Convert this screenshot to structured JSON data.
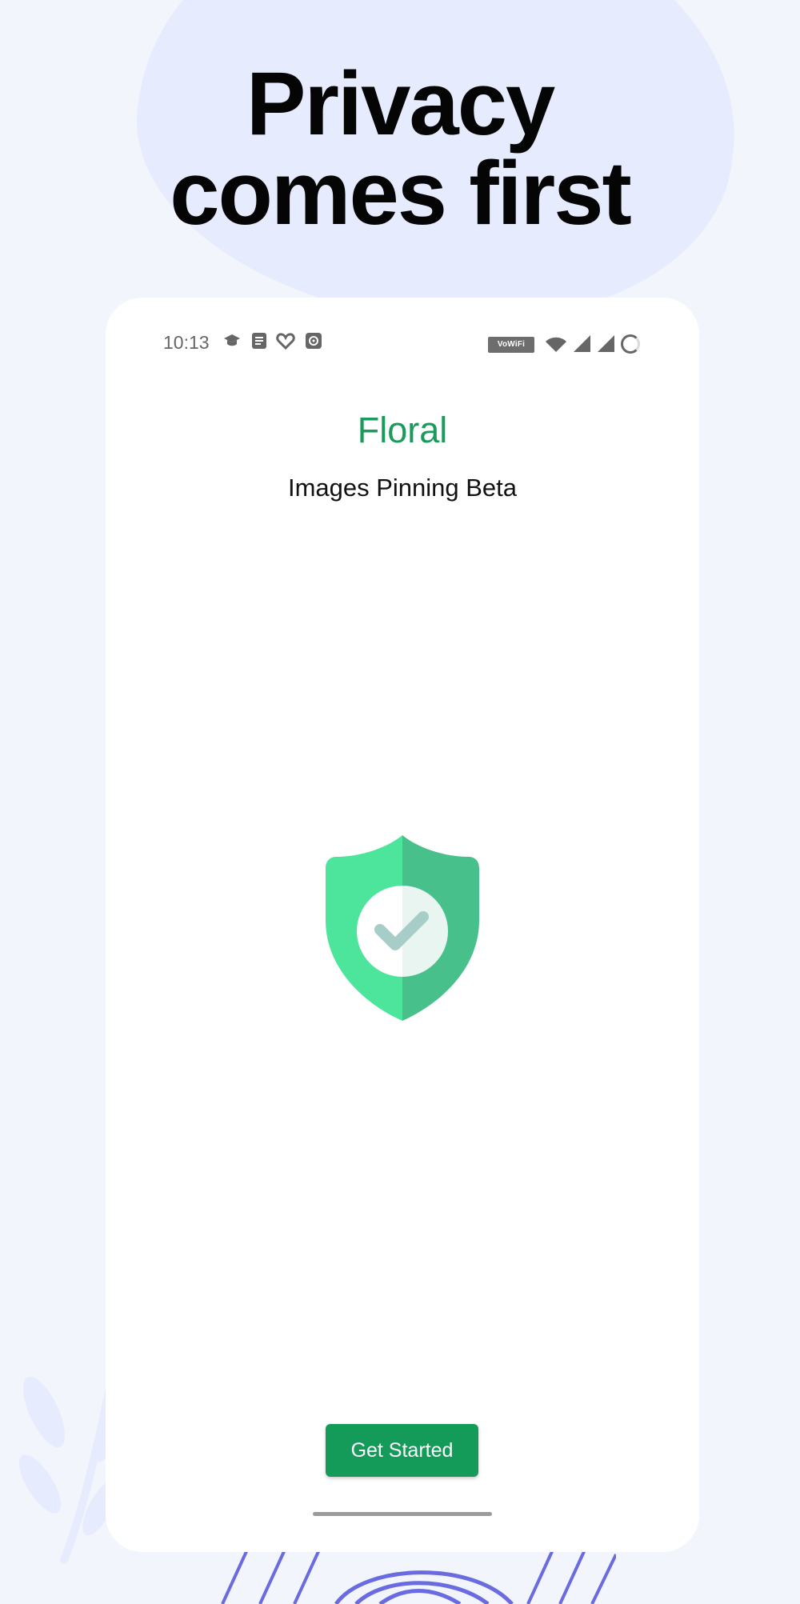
{
  "headline": {
    "cropped_top_text": "",
    "lines": [
      "Privacy",
      "comes first"
    ]
  },
  "phone": {
    "status_bar": {
      "time": "10:13",
      "icons": [
        "graduation-cap-icon",
        "document-icon",
        "heart-icon",
        "app-icon"
      ],
      "vowifi_label": "VoWiFi",
      "signal_icons": [
        "wifi-icon",
        "signal-icon",
        "signal-icon"
      ],
      "loading_icon": "loading-ring-icon"
    },
    "app": {
      "name": "Floral",
      "subtitle": "Images Pinning Beta",
      "hero_icon": "shield-check-icon",
      "cta_label": "Get Started"
    }
  },
  "colors": {
    "background": "#f3f5fc",
    "blob": "#e6ebfd",
    "accent": "#159b59",
    "shield_light": "#4de59b",
    "shield_dark": "#48c08c"
  }
}
